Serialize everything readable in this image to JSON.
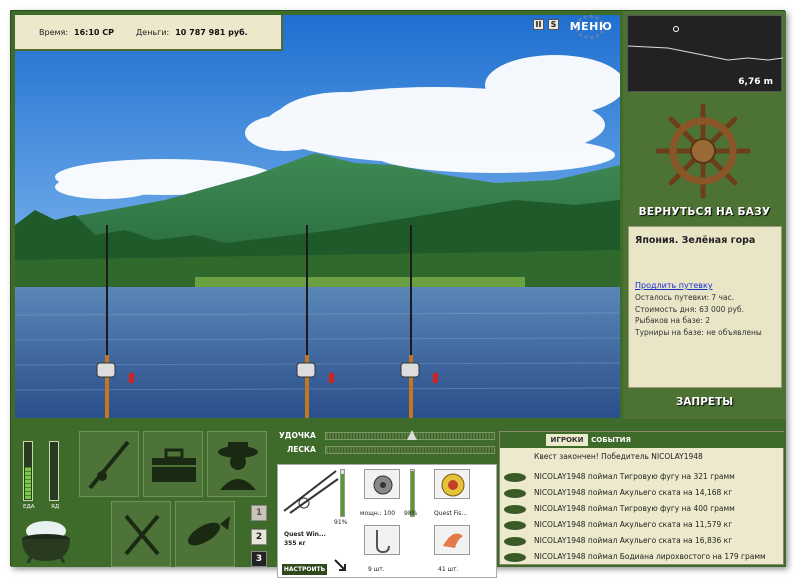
{
  "header": {
    "time_label": "Время:",
    "time_value": "16:10 СР",
    "money_label": "Деньги:",
    "money_value": "10 787 981 руб.",
    "menu_label": "МЕНЮ",
    "pause_glyph": "II",
    "sound_glyph": "S"
  },
  "map": {
    "depth": "6,76 m"
  },
  "right_panel": {
    "back_label": "ВЕРНУТЬСЯ НА БАЗУ",
    "location_name": "Япония. Зелёная гора",
    "extend_link": "Продлить путевку",
    "info_lines": [
      "Осталось путевки: 7 час.",
      "Стоимость дня: 63 000 руб.",
      "Рыбаков на базе: 2",
      "Турниры на базе: не объявлены"
    ],
    "bans_label": "ЗАПРЕТЫ"
  },
  "status": {
    "food_label": "ЕДА",
    "poison_label": "ЯД",
    "food_level": 0.55,
    "poison_level": 0.0
  },
  "pages": [
    "1",
    "2",
    "3"
  ],
  "tackle": {
    "rod_label": "УДОЧКА",
    "line_label": "ЛЕСКА",
    "rod_name": "Quest Win...",
    "rod_weight": "355 кг",
    "rod_percent": "91%",
    "reel_caption": "мощн.: 100",
    "reel_percent": "98%",
    "line_name": "Quest Fis...",
    "hook_count": "9 шт.",
    "bait_count": "41 шт.",
    "setup_label": "НАСТРОИТЬ"
  },
  "events": {
    "tab_players": "ИГРОКИ",
    "tab_events": "СОБЫТИЯ",
    "quest_line": "Квест закончен! Победитель NICOLAY1948",
    "rows": [
      "NICOLAY1948 поймал Тигровую фугу на 321 грамм",
      "NICOLAY1948 поймал Акульего ската на 14,168 кг",
      "NICOLAY1948 поймал Тигровую фугу на 400 грамм",
      "NICOLAY1948 поймал Акульего ската на 11,579 кг",
      "NICOLAY1948 поймал Акульего ската на 16,836 кг",
      "NICOLAY1948 поймал Бодиана лирохвостого на 179 грамм"
    ]
  },
  "colors": {
    "panel_green": "#3e6a2a",
    "cream": "#ece9cc",
    "link_blue": "#1a2ed0"
  }
}
